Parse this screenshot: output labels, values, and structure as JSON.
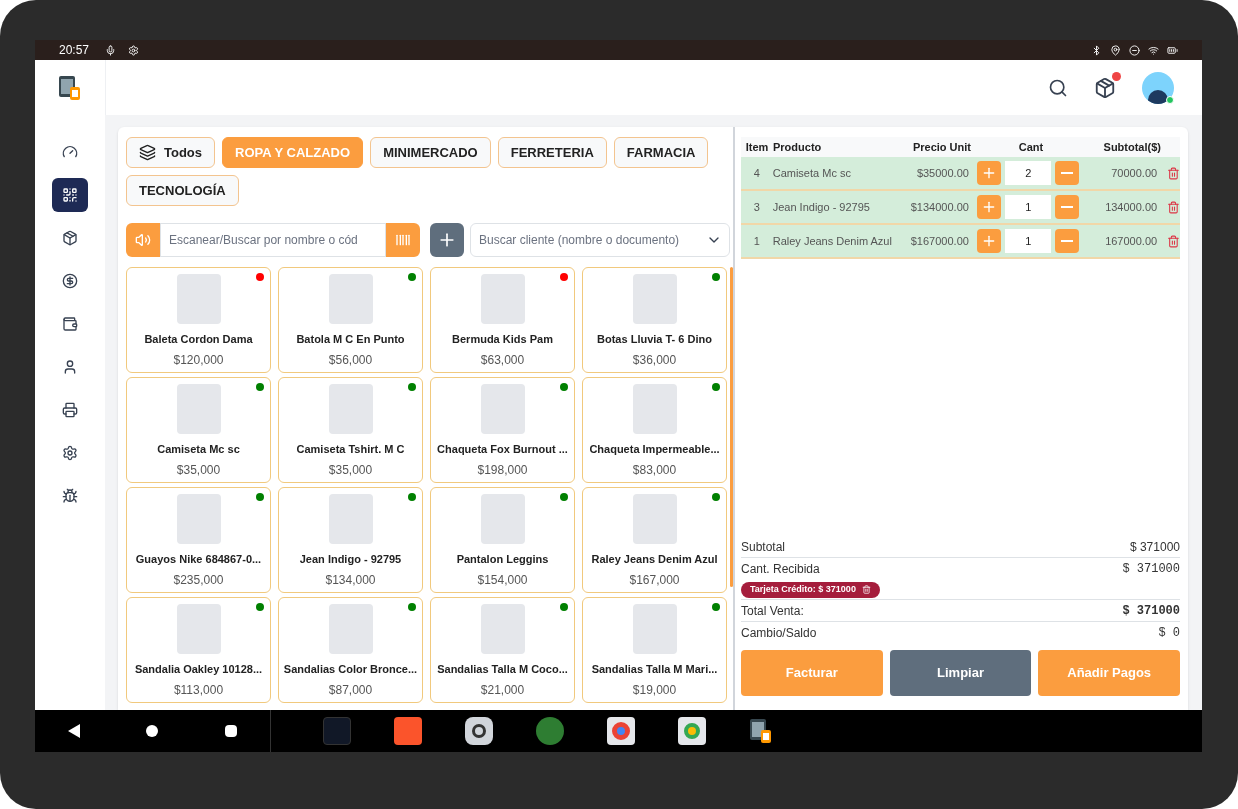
{
  "status_bar": {
    "time": "20:57"
  },
  "sidebar": {
    "items": [
      {
        "selected": false
      },
      {
        "selected": true
      },
      {
        "selected": false
      },
      {
        "selected": false
      },
      {
        "selected": false
      },
      {
        "selected": false
      },
      {
        "selected": false
      },
      {
        "selected": false
      },
      {
        "selected": false
      }
    ]
  },
  "categories": [
    {
      "label": "Todos",
      "kind": "all",
      "selected": false
    },
    {
      "label": "ROPA Y CALZADO",
      "kind": "category",
      "selected": true
    },
    {
      "label": "MINIMERCADO",
      "kind": "category",
      "selected": false
    },
    {
      "label": "FERRETERIA",
      "kind": "category",
      "selected": false
    },
    {
      "label": "FARMACIA",
      "kind": "category",
      "selected": false
    },
    {
      "label": "TECNOLOGÍA",
      "kind": "category",
      "selected": false
    }
  ],
  "product_search": {
    "placeholder": "Escanear/Buscar por nombre o cód"
  },
  "client_search": {
    "placeholder": "Buscar cliente (nombre o documento)"
  },
  "products": [
    {
      "name": "Baleta Cordon Dama",
      "price": "$120,000",
      "color": "#ff0000"
    },
    {
      "name": "Batola M C En Punto",
      "price": "$56,000",
      "color": "#008000"
    },
    {
      "name": "Bermuda Kids Pam",
      "price": "$63,000",
      "color": "#ff0000"
    },
    {
      "name": "Botas Lluvia T- 6 Dino",
      "price": "$36,000",
      "color": "#008000"
    },
    {
      "name": "Camiseta Mc sc",
      "price": "$35,000",
      "color": "#008000"
    },
    {
      "name": "Camiseta Tshirt. M C",
      "price": "$35,000",
      "color": "#008000"
    },
    {
      "name": "Chaqueta Fox Burnout ...",
      "price": "$198,000",
      "color": "#008000"
    },
    {
      "name": "Chaqueta Impermeable...",
      "price": "$83,000",
      "color": "#008000"
    },
    {
      "name": "Guayos Nike 684867-0...",
      "price": "$235,000",
      "color": "#008000"
    },
    {
      "name": "Jean Indigo - 92795",
      "price": "$134,000",
      "color": "#008000"
    },
    {
      "name": "Pantalon Leggins",
      "price": "$154,000",
      "color": "#008000"
    },
    {
      "name": "Raley Jeans Denim Azul",
      "price": "$167,000",
      "color": "#008000"
    },
    {
      "name": "Sandalia Oakley 10128...",
      "price": "$113,000",
      "color": "#008000"
    },
    {
      "name": "Sandalias Color Bronce...",
      "price": "$87,000",
      "color": "#008000"
    },
    {
      "name": "Sandalias Talla M Coco...",
      "price": "$21,000",
      "color": "#008000"
    },
    {
      "name": "Sandalias Talla M Mari...",
      "price": "$19,000",
      "color": "#008000"
    }
  ],
  "cart": {
    "columns": [
      "Item",
      "Producto",
      "Precio Unit",
      "Cant",
      "Subtotal($)"
    ],
    "rows": [
      {
        "item": "4",
        "product": "Camiseta Mc sc",
        "unit_price": "$35000.00",
        "qty": "2",
        "subtotal": "70000.00"
      },
      {
        "item": "3",
        "product": "Jean Indigo - 92795",
        "unit_price": "$134000.00",
        "qty": "1",
        "subtotal": "134000.00"
      },
      {
        "item": "1",
        "product": "Raley Jeans Denim Azul",
        "unit_price": "$167000.00",
        "qty": "1",
        "subtotal": "167000.00"
      }
    ]
  },
  "summary": {
    "subtotal_label": "Subtotal",
    "subtotal": "$ 371000",
    "received_label": "Cant. Recibida",
    "received": "$ 371000",
    "payment_tag": "Tarjeta Crédito: $ 371000",
    "total_label": "Total Venta:",
    "total": "$ 371000",
    "change_label": "Cambio/Saldo",
    "change": "$ 0"
  },
  "actions": [
    {
      "label": "Facturar",
      "kind": "primary"
    },
    {
      "label": "Limpiar",
      "kind": "secondary"
    },
    {
      "label": "Añadir Pagos",
      "kind": "primary"
    }
  ]
}
